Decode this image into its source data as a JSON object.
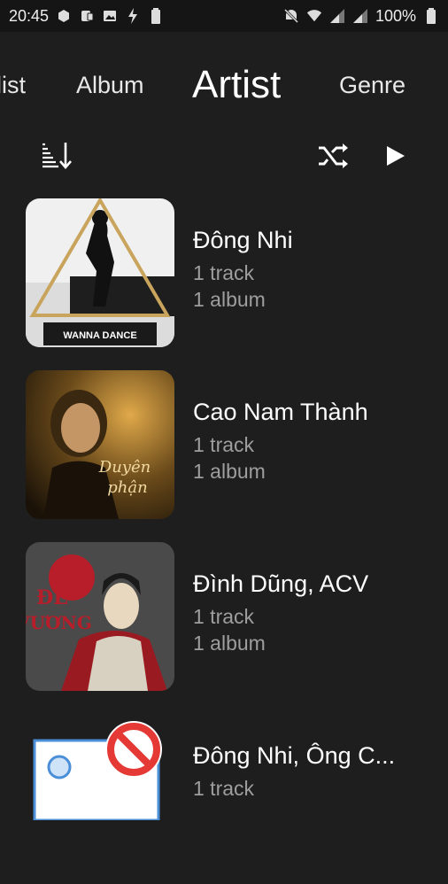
{
  "status_bar": {
    "time": "20:45",
    "battery": "100%",
    "icons_left": [
      "app-icon",
      "notification-icon",
      "image-icon",
      "charging-icon",
      "battery-saver-icon"
    ],
    "icons_right": [
      "mute-icon",
      "wifi-icon",
      "signal-icon",
      "signal-icon",
      "battery-icon"
    ]
  },
  "tabs": [
    {
      "label": "list"
    },
    {
      "label": "Album"
    },
    {
      "label": "Artist",
      "active": true
    },
    {
      "label": "Genre"
    }
  ],
  "toolbar": {
    "sort_icon": "sort-icon",
    "shuffle_icon": "shuffle-icon",
    "play_icon": "play-icon"
  },
  "artists": [
    {
      "name": "Đông Nhi",
      "tracks": "1 track",
      "albums": "1 album",
      "art_colors": [
        "#f2f2f2",
        "#1a1a1a",
        "#c9a45c"
      ],
      "art_text": "WANNA DANCE"
    },
    {
      "name": "Cao Nam Thành",
      "tracks": "1 track",
      "albums": "1 album",
      "art_colors": [
        "#3a2a12",
        "#d9a441",
        "#1c1208"
      ],
      "art_text": "Duyên phận"
    },
    {
      "name": "Đình Dũng, ACV",
      "tracks": "1 track",
      "albums": "1 album",
      "art_colors": [
        "#4a4a4a",
        "#b81e2a",
        "#e8e0d0"
      ],
      "art_text": "ĐẾ VƯƠNG"
    },
    {
      "name": "Đông Nhi, Ông C...",
      "tracks": "1 track",
      "albums": "",
      "art_colors": [
        "#ffffff",
        "#4a8fd8",
        "#e53935"
      ],
      "art_text": ""
    }
  ],
  "colors": {
    "background": "#1e1e1e",
    "status_bar": "#151515",
    "text_primary": "#ffffff",
    "text_secondary": "#9e9e9e"
  }
}
